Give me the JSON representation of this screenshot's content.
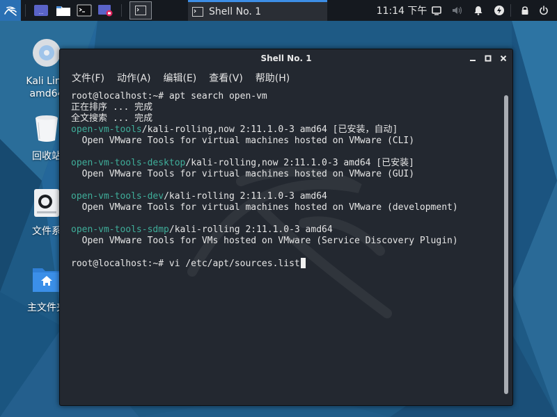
{
  "desktop": {
    "icons": [
      {
        "name": "kali-drive",
        "label1": "Kali Linu",
        "label2": "amd64"
      },
      {
        "name": "trash",
        "label1": "回收站"
      },
      {
        "name": "filesystem",
        "label1": "文件系"
      },
      {
        "name": "home",
        "label1": "主文件夹"
      }
    ]
  },
  "taskbar": {
    "icons": [
      "kali-dragon-icon",
      "workspace-icon",
      "file-manager-icon",
      "terminal-icon",
      "screen-recorder-icon"
    ],
    "window_button_label": "Shell No. 1",
    "clock": "11:14 下午",
    "tray_icons": [
      "display-icon",
      "volume-icon",
      "notifications-icon",
      "power-icon",
      "window-icon",
      "lock-icon",
      "power-icon"
    ]
  },
  "window": {
    "title": "Shell No. 1",
    "controls": {
      "minimize": "–",
      "maximize": "□",
      "close": "✕"
    },
    "menus": [
      "文件(F)",
      "动作(A)",
      "编辑(E)",
      "查看(V)",
      "帮助(H)"
    ]
  },
  "terminal": {
    "lines": [
      {
        "type": "cmd",
        "text": "root@localhost:~# apt search open-vm"
      },
      {
        "type": "text",
        "text": "正在排序 ... 完成"
      },
      {
        "type": "text",
        "text": "全文搜索 ... 完成"
      },
      {
        "type": "pkg",
        "pkg": "open-vm-tools",
        "rest": "/kali-rolling,now 2:11.1.0-3 amd64 [已安装，自动]"
      },
      {
        "type": "text",
        "text": "  Open VMware Tools for virtual machines hosted on VMware (CLI)"
      },
      {
        "type": "blank",
        "text": ""
      },
      {
        "type": "pkg",
        "pkg": "open-vm-tools-desktop",
        "rest": "/kali-rolling,now 2:11.1.0-3 amd64 [已安装]"
      },
      {
        "type": "text",
        "text": "  Open VMware Tools for virtual machines hosted on VMware (GUI)"
      },
      {
        "type": "blank",
        "text": ""
      },
      {
        "type": "pkg",
        "pkg": "open-vm-tools-dev",
        "rest": "/kali-rolling 2:11.1.0-3 amd64"
      },
      {
        "type": "text",
        "text": "  Open VMware Tools for virtual machines hosted on VMware (development)"
      },
      {
        "type": "blank",
        "text": ""
      },
      {
        "type": "pkg",
        "pkg": "open-vm-tools-sdmp",
        "rest": "/kali-rolling 2:11.1.0-3 amd64"
      },
      {
        "type": "text",
        "text": "  Open VMware Tools for VMs hosted on VMware (Service Discovery Plugin)"
      },
      {
        "type": "blank",
        "text": ""
      },
      {
        "type": "prompt",
        "text": "root@localhost:~# vi /etc/apt/sources.list"
      }
    ]
  },
  "colors": {
    "package_name": "#3fae9a",
    "terminal_bg": "#232830",
    "panel_bg": "#15191f",
    "accent": "#3d8ee6"
  }
}
